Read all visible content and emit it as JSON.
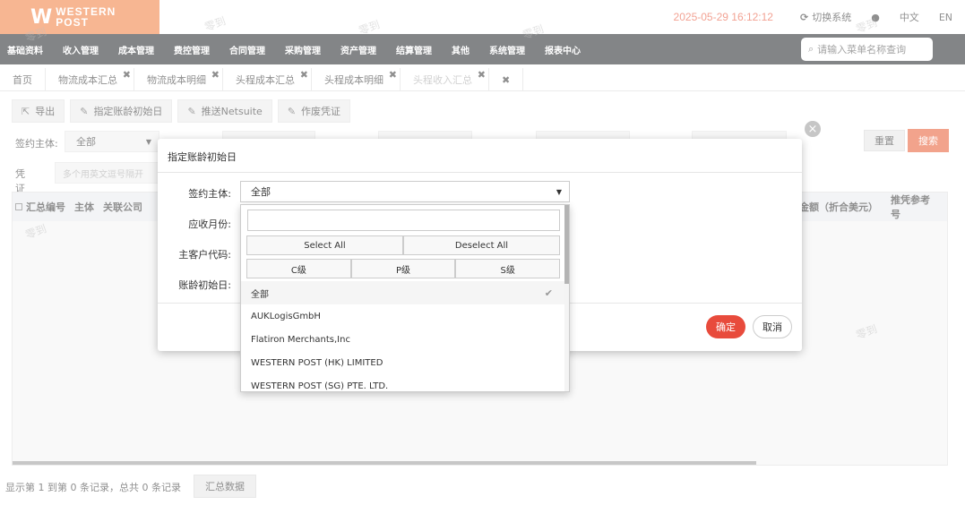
{
  "brand": {
    "line1": "WESTERN",
    "line2": "POST"
  },
  "header": {
    "datetime": "2025-05-29 16:12:12",
    "switch_system": "切换系统",
    "lang_zh": "中文",
    "lang_en": "EN"
  },
  "menu": {
    "items": [
      "基础资料",
      "收入管理",
      "成本管理",
      "费控管理",
      "合同管理",
      "采购管理",
      "资产管理",
      "结算管理",
      "其他",
      "系统管理",
      "报表中心"
    ],
    "search_placeholder": "请输入菜单名称查询"
  },
  "tabs": [
    {
      "label": "首页",
      "closable": false
    },
    {
      "label": "物流成本汇总",
      "closable": true
    },
    {
      "label": "物流成本明细",
      "closable": true
    },
    {
      "label": "头程成本汇总",
      "closable": true
    },
    {
      "label": "头程成本明细",
      "closable": true
    },
    {
      "label": "头程收入汇总",
      "closable": true,
      "active": true
    }
  ],
  "toolbar": {
    "export": "导出",
    "set_aging_start": "指定账龄初始日",
    "push_netsuite": "推送Netsuite",
    "void_voucher": "作废凭证"
  },
  "filters": {
    "entity_label": "签约主体:",
    "entity_value": "全部",
    "voucher_label": "凭证号:",
    "voucher_placeholder": "多个用英文逗号隔开",
    "reset": "重置",
    "search": "搜索"
  },
  "grid": {
    "columns_left": [
      "汇总编号",
      "主体",
      "关联公司"
    ],
    "columns_right": [
      "金额（折合美元）",
      "推凭参考号"
    ]
  },
  "footer": {
    "record_text": "显示第 1 到第 0 条记录，总共 0 条记录",
    "summary_button": "汇总数据"
  },
  "watermark_text": "零到",
  "dialog": {
    "title": "指定账龄初始日",
    "labels": {
      "entity": "签约主体:",
      "receivable_month": "应收月份:",
      "main_customer_code": "主客户代码:",
      "aging_start": "账龄初始日:"
    },
    "entity_value": "全部",
    "ok": "确定",
    "cancel": "取消"
  },
  "dropdown": {
    "select_all": "Select All",
    "deselect_all": "Deselect All",
    "levels": [
      "C级",
      "P级",
      "S级"
    ],
    "options": [
      {
        "label": "全部",
        "selected": true
      },
      {
        "label": "AUKLogisGmbH",
        "selected": false
      },
      {
        "label": "Flatiron Merchants,Inc",
        "selected": false
      },
      {
        "label": "WESTERN POST (HK) LIMITED",
        "selected": false
      },
      {
        "label": "WESTERN POST (SG) PTE. LTD.",
        "selected": false
      }
    ]
  }
}
